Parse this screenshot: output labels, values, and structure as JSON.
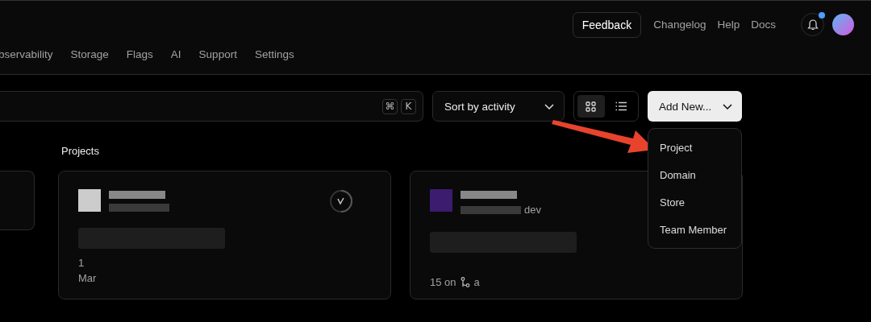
{
  "header": {
    "feedback": "Feedback",
    "links": [
      "Changelog",
      "Help",
      "Docs"
    ],
    "notifications": {
      "unread": true
    }
  },
  "nav": {
    "tabs": [
      {
        "label": "bservability",
        "selected": false
      },
      {
        "label": "Storage",
        "selected": false
      },
      {
        "label": "Flags",
        "selected": false
      },
      {
        "label": "AI",
        "selected": false
      },
      {
        "label": "Support",
        "selected": false
      },
      {
        "label": "Settings",
        "selected": false
      }
    ]
  },
  "toolbar": {
    "search": {
      "shortcut_keys": [
        "⌘",
        "K"
      ]
    },
    "sort": {
      "label": "Sort by activity"
    },
    "view_toggle": [
      {
        "kind": "grid",
        "selected": true
      },
      {
        "kind": "list",
        "selected": false
      }
    ],
    "add_new": {
      "label": "Add New...",
      "expanded": true
    }
  },
  "menu": {
    "items": [
      "Project",
      "Domain",
      "Store",
      "Team Member"
    ]
  },
  "section_title": "Projects",
  "cards": [
    {
      "kind": "partial"
    },
    {
      "kind": "full",
      "status_ring": true,
      "count": "1",
      "date": "Mar"
    },
    {
      "kind": "full",
      "status_ring": false,
      "domain_suffix": "dev",
      "date": "15 on",
      "branch": "a"
    }
  ]
}
